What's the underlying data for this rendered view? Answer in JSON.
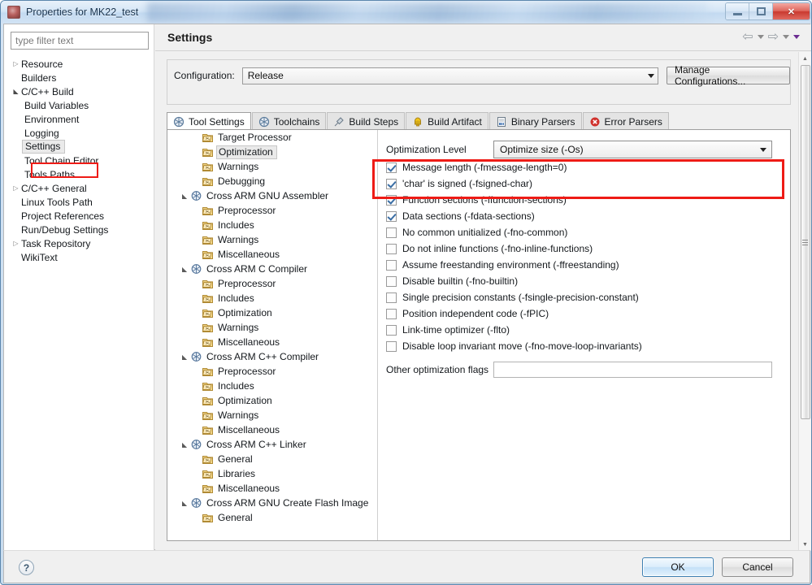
{
  "window": {
    "title": "Properties for MK22_test",
    "app_icon": "properties-app-icon",
    "minimize": "–",
    "maximize": "❐",
    "close": "✕"
  },
  "filter": {
    "placeholder": "type filter text",
    "value": ""
  },
  "nav_tree": [
    {
      "label": "Resource",
      "indent": 0,
      "arrow": "collapsed",
      "selected": false
    },
    {
      "label": "Builders",
      "indent": 0,
      "arrow": "none",
      "selected": false
    },
    {
      "label": "C/C++ Build",
      "indent": 0,
      "arrow": "expanded",
      "selected": false
    },
    {
      "label": "Build Variables",
      "indent": 1,
      "arrow": "none",
      "selected": false
    },
    {
      "label": "Environment",
      "indent": 1,
      "arrow": "none",
      "selected": false
    },
    {
      "label": "Logging",
      "indent": 1,
      "arrow": "none",
      "selected": false
    },
    {
      "label": "Settings",
      "indent": 1,
      "arrow": "none",
      "selected": true
    },
    {
      "label": "Tool Chain Editor",
      "indent": 1,
      "arrow": "none",
      "selected": false
    },
    {
      "label": "Tools Paths",
      "indent": 1,
      "arrow": "none",
      "selected": false
    },
    {
      "label": "C/C++ General",
      "indent": 0,
      "arrow": "collapsed",
      "selected": false
    },
    {
      "label": "Linux Tools Path",
      "indent": 0,
      "arrow": "none",
      "selected": false
    },
    {
      "label": "Project References",
      "indent": 0,
      "arrow": "none",
      "selected": false
    },
    {
      "label": "Run/Debug Settings",
      "indent": 0,
      "arrow": "none",
      "selected": false
    },
    {
      "label": "Task Repository",
      "indent": 0,
      "arrow": "collapsed",
      "selected": false
    },
    {
      "label": "WikiText",
      "indent": 0,
      "arrow": "none",
      "selected": false
    }
  ],
  "page": {
    "title": "Settings",
    "nav_back": "back-arrow",
    "nav_forward": "forward-arrow",
    "menu_caret": "view-menu-arrow"
  },
  "configuration": {
    "label": "Configuration:",
    "value": "Release",
    "manage_button": "Manage Configurations..."
  },
  "tabs": [
    {
      "label": "Tool Settings",
      "icon": "tool-settings-icon",
      "active": true
    },
    {
      "label": "Toolchains",
      "icon": "toolchains-icon",
      "active": false
    },
    {
      "label": "Build Steps",
      "icon": "build-steps-icon",
      "active": false
    },
    {
      "label": "Build Artifact",
      "icon": "build-artifact-icon",
      "active": false
    },
    {
      "label": "Binary Parsers",
      "icon": "binary-parsers-icon",
      "active": false
    },
    {
      "label": "Error Parsers",
      "icon": "error-parsers-icon",
      "active": false
    }
  ],
  "tool_tree": [
    {
      "label": "Target Processor",
      "level": 2,
      "arrow": "none",
      "icon": "option-page-icon",
      "selected": false
    },
    {
      "label": "Optimization",
      "level": 2,
      "arrow": "none",
      "icon": "option-page-icon",
      "selected": true
    },
    {
      "label": "Warnings",
      "level": 2,
      "arrow": "none",
      "icon": "option-page-icon",
      "selected": false
    },
    {
      "label": "Debugging",
      "level": 2,
      "arrow": "none",
      "icon": "option-page-icon",
      "selected": false
    },
    {
      "label": "Cross ARM GNU Assembler",
      "level": 1,
      "arrow": "expanded",
      "icon": "tool-icon",
      "selected": false
    },
    {
      "label": "Preprocessor",
      "level": 2,
      "arrow": "none",
      "icon": "option-page-icon",
      "selected": false
    },
    {
      "label": "Includes",
      "level": 2,
      "arrow": "none",
      "icon": "option-page-icon",
      "selected": false
    },
    {
      "label": "Warnings",
      "level": 2,
      "arrow": "none",
      "icon": "option-page-icon",
      "selected": false
    },
    {
      "label": "Miscellaneous",
      "level": 2,
      "arrow": "none",
      "icon": "option-page-icon",
      "selected": false
    },
    {
      "label": "Cross ARM C Compiler",
      "level": 1,
      "arrow": "expanded",
      "icon": "tool-icon",
      "selected": false
    },
    {
      "label": "Preprocessor",
      "level": 2,
      "arrow": "none",
      "icon": "option-page-icon",
      "selected": false
    },
    {
      "label": "Includes",
      "level": 2,
      "arrow": "none",
      "icon": "option-page-icon",
      "selected": false
    },
    {
      "label": "Optimization",
      "level": 2,
      "arrow": "none",
      "icon": "option-page-icon",
      "selected": false
    },
    {
      "label": "Warnings",
      "level": 2,
      "arrow": "none",
      "icon": "option-page-icon",
      "selected": false
    },
    {
      "label": "Miscellaneous",
      "level": 2,
      "arrow": "none",
      "icon": "option-page-icon",
      "selected": false
    },
    {
      "label": "Cross ARM C++ Compiler",
      "level": 1,
      "arrow": "expanded",
      "icon": "tool-icon",
      "selected": false
    },
    {
      "label": "Preprocessor",
      "level": 2,
      "arrow": "none",
      "icon": "option-page-icon",
      "selected": false
    },
    {
      "label": "Includes",
      "level": 2,
      "arrow": "none",
      "icon": "option-page-icon",
      "selected": false
    },
    {
      "label": "Optimization",
      "level": 2,
      "arrow": "none",
      "icon": "option-page-icon",
      "selected": false
    },
    {
      "label": "Warnings",
      "level": 2,
      "arrow": "none",
      "icon": "option-page-icon",
      "selected": false
    },
    {
      "label": "Miscellaneous",
      "level": 2,
      "arrow": "none",
      "icon": "option-page-icon",
      "selected": false
    },
    {
      "label": "Cross ARM C++ Linker",
      "level": 1,
      "arrow": "expanded",
      "icon": "tool-icon",
      "selected": false
    },
    {
      "label": "General",
      "level": 2,
      "arrow": "none",
      "icon": "option-page-icon",
      "selected": false
    },
    {
      "label": "Libraries",
      "level": 2,
      "arrow": "none",
      "icon": "option-page-icon",
      "selected": false
    },
    {
      "label": "Miscellaneous",
      "level": 2,
      "arrow": "none",
      "icon": "option-page-icon",
      "selected": false
    },
    {
      "label": "Cross ARM GNU Create Flash Image",
      "level": 1,
      "arrow": "expanded",
      "icon": "tool-icon",
      "selected": false
    },
    {
      "label": "General",
      "level": 2,
      "arrow": "none",
      "icon": "option-page-icon",
      "selected": false
    }
  ],
  "optimization": {
    "level_label": "Optimization Level",
    "level_value": "Optimize size (-Os)",
    "checkboxes": [
      {
        "label": "Message length (-fmessage-length=0)",
        "checked": true
      },
      {
        "label": "'char' is signed (-fsigned-char)",
        "checked": true
      },
      {
        "label": "Function sections (-ffunction-sections)",
        "checked": true
      },
      {
        "label": "Data sections (-fdata-sections)",
        "checked": true
      },
      {
        "label": "No common unitialized (-fno-common)",
        "checked": false
      },
      {
        "label": "Do not inline functions (-fno-inline-functions)",
        "checked": false
      },
      {
        "label": "Assume freestanding environment (-ffreestanding)",
        "checked": false
      },
      {
        "label": "Disable builtin (-fno-builtin)",
        "checked": false
      },
      {
        "label": "Single precision constants (-fsingle-precision-constant)",
        "checked": false
      },
      {
        "label": "Position independent code (-fPIC)",
        "checked": false
      },
      {
        "label": "Link-time optimizer (-flto)",
        "checked": false
      },
      {
        "label": "Disable loop invariant move (-fno-move-loop-invariants)",
        "checked": false
      }
    ],
    "other_flags_label": "Other optimization flags",
    "other_flags_value": ""
  },
  "footer": {
    "help": "?",
    "ok_label": "OK",
    "cancel_label": "Cancel"
  },
  "annotation": {
    "color": "#ee1b16",
    "targets": [
      "settings-nav-item",
      "optimization-level-row"
    ]
  }
}
